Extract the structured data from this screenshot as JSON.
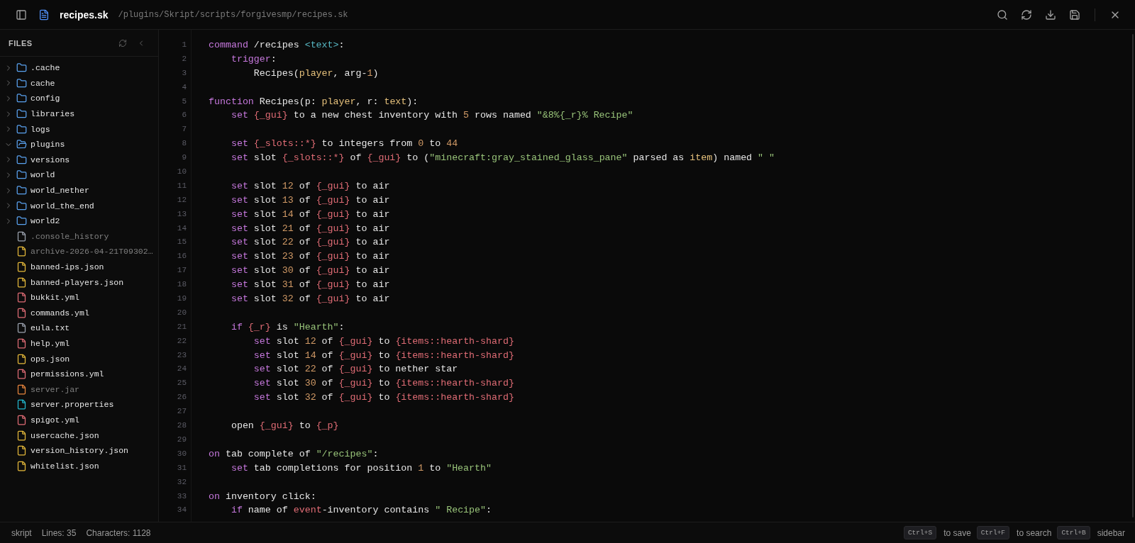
{
  "header": {
    "file_name": "recipes.sk",
    "path": "/plugins/Skript/scripts/forgivesmp/recipes.sk"
  },
  "sidebar": {
    "title": "FILES",
    "items": [
      {
        "kind": "folder",
        "name": ".cache",
        "expanded": false
      },
      {
        "kind": "folder",
        "name": "cache",
        "expanded": false
      },
      {
        "kind": "folder",
        "name": "config",
        "expanded": false
      },
      {
        "kind": "folder",
        "name": "libraries",
        "expanded": false
      },
      {
        "kind": "folder",
        "name": "logs",
        "expanded": false
      },
      {
        "kind": "folder",
        "name": "plugins",
        "expanded": true
      },
      {
        "kind": "folder",
        "name": "versions",
        "expanded": false
      },
      {
        "kind": "folder",
        "name": "world",
        "expanded": false
      },
      {
        "kind": "folder",
        "name": "world_nether",
        "expanded": false
      },
      {
        "kind": "folder",
        "name": "world_the_end",
        "expanded": false
      },
      {
        "kind": "folder",
        "name": "world2",
        "expanded": false
      },
      {
        "kind": "file",
        "name": ".console_history",
        "color": "#9ca3af",
        "dimmed": true
      },
      {
        "kind": "file",
        "name": "archive-2026-04-21T09302…",
        "color": "#e5b93a",
        "dimmed": true
      },
      {
        "kind": "file",
        "name": "banned-ips.json",
        "color": "#e5b93a",
        "dimmed": false
      },
      {
        "kind": "file",
        "name": "banned-players.json",
        "color": "#e5b93a",
        "dimmed": false
      },
      {
        "kind": "file",
        "name": "bukkit.yml",
        "color": "#e06c75",
        "dimmed": false
      },
      {
        "kind": "file",
        "name": "commands.yml",
        "color": "#e06c75",
        "dimmed": false
      },
      {
        "kind": "file",
        "name": "eula.txt",
        "color": "#9ca3af",
        "dimmed": false
      },
      {
        "kind": "file",
        "name": "help.yml",
        "color": "#e06c75",
        "dimmed": false
      },
      {
        "kind": "file",
        "name": "ops.json",
        "color": "#e5b93a",
        "dimmed": false
      },
      {
        "kind": "file",
        "name": "permissions.yml",
        "color": "#e06c75",
        "dimmed": false
      },
      {
        "kind": "file",
        "name": "server.jar",
        "color": "#e8853d",
        "dimmed": true
      },
      {
        "kind": "file",
        "name": "server.properties",
        "color": "#22b8cf",
        "dimmed": false
      },
      {
        "kind": "file",
        "name": "spigot.yml",
        "color": "#e06c75",
        "dimmed": false
      },
      {
        "kind": "file",
        "name": "usercache.json",
        "color": "#e5b93a",
        "dimmed": false
      },
      {
        "kind": "file",
        "name": "version_history.json",
        "color": "#e5b93a",
        "dimmed": false
      },
      {
        "kind": "file",
        "name": "whitelist.json",
        "color": "#e5b93a",
        "dimmed": false
      }
    ]
  },
  "editor": {
    "lines": [
      {
        "number": "1",
        "tokens": [
          {
            "kind": "keyword",
            "text": "command"
          },
          {
            "kind": "plain",
            "text": " /recipes "
          },
          {
            "kind": "tag",
            "text": "<text>"
          },
          {
            "kind": "plain",
            "text": ":"
          }
        ]
      },
      {
        "number": "2",
        "tokens": [
          {
            "kind": "keyword",
            "text": "    trigger"
          },
          {
            "kind": "plain",
            "text": ":"
          }
        ]
      },
      {
        "number": "3",
        "tokens": [
          {
            "kind": "plain",
            "text": "        Recipes("
          },
          {
            "kind": "type",
            "text": "player"
          },
          {
            "kind": "plain",
            "text": ", arg-"
          },
          {
            "kind": "number",
            "text": "1"
          },
          {
            "kind": "plain",
            "text": ")"
          }
        ]
      },
      {
        "number": "4"
      },
      {
        "number": "5",
        "tokens": [
          {
            "kind": "keyword",
            "text": "function"
          },
          {
            "kind": "plain",
            "text": " Recipes(p: "
          },
          {
            "kind": "type",
            "text": "player"
          },
          {
            "kind": "plain",
            "text": ", r: "
          },
          {
            "kind": "type",
            "text": "text"
          },
          {
            "kind": "plain",
            "text": "):"
          }
        ]
      },
      {
        "number": "6",
        "tokens": [
          {
            "kind": "keyword",
            "text": "    set"
          },
          {
            "kind": "variable",
            "text": " {_gui}"
          },
          {
            "kind": "plain",
            "text": " to a new chest inventory with "
          },
          {
            "kind": "number",
            "text": "5"
          },
          {
            "kind": "plain",
            "text": " rows named "
          },
          {
            "kind": "string",
            "text": "\"&8%{_r}% Recipe\""
          }
        ]
      },
      {
        "number": "7"
      },
      {
        "number": "8",
        "tokens": [
          {
            "kind": "keyword",
            "text": "    set"
          },
          {
            "kind": "variable",
            "text": " {_slots::*}"
          },
          {
            "kind": "plain",
            "text": " to integers from "
          },
          {
            "kind": "number",
            "text": "0"
          },
          {
            "kind": "plain",
            "text": " to "
          },
          {
            "kind": "number",
            "text": "44"
          }
        ]
      },
      {
        "number": "9",
        "tokens": [
          {
            "kind": "keyword",
            "text": "    set"
          },
          {
            "kind": "plain",
            "text": " slot "
          },
          {
            "kind": "variable",
            "text": "{_slots::*}"
          },
          {
            "kind": "plain",
            "text": " of "
          },
          {
            "kind": "variable",
            "text": "{_gui}"
          },
          {
            "kind": "plain",
            "text": " to ("
          },
          {
            "kind": "string",
            "text": "\"minecraft:gray_stained_glass_pane\""
          },
          {
            "kind": "plain",
            "text": " parsed as "
          },
          {
            "kind": "type",
            "text": "item"
          },
          {
            "kind": "plain",
            "text": ") named "
          },
          {
            "kind": "string",
            "text": "\" \""
          }
        ]
      },
      {
        "number": "10"
      },
      {
        "number": "11",
        "tokens": [
          {
            "kind": "keyword",
            "text": "    set"
          },
          {
            "kind": "plain",
            "text": " slot "
          },
          {
            "kind": "number",
            "text": "12"
          },
          {
            "kind": "plain",
            "text": " of "
          },
          {
            "kind": "variable",
            "text": "{_gui}"
          },
          {
            "kind": "plain",
            "text": " to air"
          }
        ]
      },
      {
        "number": "12",
        "tokens": [
          {
            "kind": "keyword",
            "text": "    set"
          },
          {
            "kind": "plain",
            "text": " slot "
          },
          {
            "kind": "number",
            "text": "13"
          },
          {
            "kind": "plain",
            "text": " of "
          },
          {
            "kind": "variable",
            "text": "{_gui}"
          },
          {
            "kind": "plain",
            "text": " to air"
          }
        ]
      },
      {
        "number": "13",
        "tokens": [
          {
            "kind": "keyword",
            "text": "    set"
          },
          {
            "kind": "plain",
            "text": " slot "
          },
          {
            "kind": "number",
            "text": "14"
          },
          {
            "kind": "plain",
            "text": " of "
          },
          {
            "kind": "variable",
            "text": "{_gui}"
          },
          {
            "kind": "plain",
            "text": " to air"
          }
        ]
      },
      {
        "number": "14",
        "tokens": [
          {
            "kind": "keyword",
            "text": "    set"
          },
          {
            "kind": "plain",
            "text": " slot "
          },
          {
            "kind": "number",
            "text": "21"
          },
          {
            "kind": "plain",
            "text": " of "
          },
          {
            "kind": "variable",
            "text": "{_gui}"
          },
          {
            "kind": "plain",
            "text": " to air"
          }
        ]
      },
      {
        "number": "15",
        "tokens": [
          {
            "kind": "keyword",
            "text": "    set"
          },
          {
            "kind": "plain",
            "text": " slot "
          },
          {
            "kind": "number",
            "text": "22"
          },
          {
            "kind": "plain",
            "text": " of "
          },
          {
            "kind": "variable",
            "text": "{_gui}"
          },
          {
            "kind": "plain",
            "text": " to air"
          }
        ]
      },
      {
        "number": "16",
        "tokens": [
          {
            "kind": "keyword",
            "text": "    set"
          },
          {
            "kind": "plain",
            "text": " slot "
          },
          {
            "kind": "number",
            "text": "23"
          },
          {
            "kind": "plain",
            "text": " of "
          },
          {
            "kind": "variable",
            "text": "{_gui}"
          },
          {
            "kind": "plain",
            "text": " to air"
          }
        ]
      },
      {
        "number": "17",
        "tokens": [
          {
            "kind": "keyword",
            "text": "    set"
          },
          {
            "kind": "plain",
            "text": " slot "
          },
          {
            "kind": "number",
            "text": "30"
          },
          {
            "kind": "plain",
            "text": " of "
          },
          {
            "kind": "variable",
            "text": "{_gui}"
          },
          {
            "kind": "plain",
            "text": " to air"
          }
        ]
      },
      {
        "number": "18",
        "tokens": [
          {
            "kind": "keyword",
            "text": "    set"
          },
          {
            "kind": "plain",
            "text": " slot "
          },
          {
            "kind": "number",
            "text": "31"
          },
          {
            "kind": "plain",
            "text": " of "
          },
          {
            "kind": "variable",
            "text": "{_gui}"
          },
          {
            "kind": "plain",
            "text": " to air"
          }
        ]
      },
      {
        "number": "19",
        "tokens": [
          {
            "kind": "keyword",
            "text": "    set"
          },
          {
            "kind": "plain",
            "text": " slot "
          },
          {
            "kind": "number",
            "text": "32"
          },
          {
            "kind": "plain",
            "text": " of "
          },
          {
            "kind": "variable",
            "text": "{_gui}"
          },
          {
            "kind": "plain",
            "text": " to air"
          }
        ]
      },
      {
        "number": "20"
      },
      {
        "number": "21",
        "tokens": [
          {
            "kind": "keyword",
            "text": "    if"
          },
          {
            "kind": "variable",
            "text": " {_r}"
          },
          {
            "kind": "plain",
            "text": " is "
          },
          {
            "kind": "string",
            "text": "\"Hearth\""
          },
          {
            "kind": "plain",
            "text": ":"
          }
        ]
      },
      {
        "number": "22",
        "tokens": [
          {
            "kind": "keyword",
            "text": "        set"
          },
          {
            "kind": "plain",
            "text": " slot "
          },
          {
            "kind": "number",
            "text": "12"
          },
          {
            "kind": "plain",
            "text": " of "
          },
          {
            "kind": "variable",
            "text": "{_gui}"
          },
          {
            "kind": "plain",
            "text": " to "
          },
          {
            "kind": "variable",
            "text": "{items::hearth-shard}"
          }
        ]
      },
      {
        "number": "23",
        "tokens": [
          {
            "kind": "keyword",
            "text": "        set"
          },
          {
            "kind": "plain",
            "text": " slot "
          },
          {
            "kind": "number",
            "text": "14"
          },
          {
            "kind": "plain",
            "text": " of "
          },
          {
            "kind": "variable",
            "text": "{_gui}"
          },
          {
            "kind": "plain",
            "text": " to "
          },
          {
            "kind": "variable",
            "text": "{items::hearth-shard}"
          }
        ]
      },
      {
        "number": "24",
        "tokens": [
          {
            "kind": "keyword",
            "text": "        set"
          },
          {
            "kind": "plain",
            "text": " slot "
          },
          {
            "kind": "number",
            "text": "22"
          },
          {
            "kind": "plain",
            "text": " of "
          },
          {
            "kind": "variable",
            "text": "{_gui}"
          },
          {
            "kind": "plain",
            "text": " to nether star"
          }
        ]
      },
      {
        "number": "25",
        "tokens": [
          {
            "kind": "keyword",
            "text": "        set"
          },
          {
            "kind": "plain",
            "text": " slot "
          },
          {
            "kind": "number",
            "text": "30"
          },
          {
            "kind": "plain",
            "text": " of "
          },
          {
            "kind": "variable",
            "text": "{_gui}"
          },
          {
            "kind": "plain",
            "text": " to "
          },
          {
            "kind": "variable",
            "text": "{items::hearth-shard}"
          }
        ]
      },
      {
        "number": "26",
        "tokens": [
          {
            "kind": "keyword",
            "text": "        set"
          },
          {
            "kind": "plain",
            "text": " slot "
          },
          {
            "kind": "number",
            "text": "32"
          },
          {
            "kind": "plain",
            "text": " of "
          },
          {
            "kind": "variable",
            "text": "{_gui}"
          },
          {
            "kind": "plain",
            "text": " to "
          },
          {
            "kind": "variable",
            "text": "{items::hearth-shard}"
          }
        ]
      },
      {
        "number": "27"
      },
      {
        "number": "28",
        "tokens": [
          {
            "kind": "plain",
            "text": "    open "
          },
          {
            "kind": "variable",
            "text": "{_gui}"
          },
          {
            "kind": "plain",
            "text": " to "
          },
          {
            "kind": "variable",
            "text": "{_p}"
          }
        ]
      },
      {
        "number": "29"
      },
      {
        "number": "30",
        "tokens": [
          {
            "kind": "keyword",
            "text": "on"
          },
          {
            "kind": "plain",
            "text": " tab complete of "
          },
          {
            "kind": "string",
            "text": "\"/recipes\""
          },
          {
            "kind": "plain",
            "text": ":"
          }
        ]
      },
      {
        "number": "31",
        "tokens": [
          {
            "kind": "keyword",
            "text": "    set"
          },
          {
            "kind": "plain",
            "text": " tab completions for position "
          },
          {
            "kind": "number",
            "text": "1"
          },
          {
            "kind": "plain",
            "text": " to "
          },
          {
            "kind": "string",
            "text": "\"Hearth\""
          }
        ]
      },
      {
        "number": "32"
      },
      {
        "number": "33",
        "tokens": [
          {
            "kind": "keyword",
            "text": "on"
          },
          {
            "kind": "plain",
            "text": " inventory click:"
          }
        ]
      },
      {
        "number": "34",
        "tokens": [
          {
            "kind": "keyword",
            "text": "    if"
          },
          {
            "kind": "plain",
            "text": " name of "
          },
          {
            "kind": "variable",
            "text": "event"
          },
          {
            "kind": "plain",
            "text": "-inventory contains "
          },
          {
            "kind": "string",
            "text": "\" Recipe\""
          },
          {
            "kind": "plain",
            "text": ":"
          }
        ]
      }
    ]
  },
  "status_bar": {
    "left": [
      "skript",
      "Lines: 35",
      "Characters: 1128"
    ],
    "shortcuts": [
      {
        "key": "Ctrl+S",
        "label": "to save"
      },
      {
        "key": "Ctrl+F",
        "label": "to search"
      },
      {
        "key": "Ctrl+B",
        "label": "sidebar"
      }
    ]
  }
}
